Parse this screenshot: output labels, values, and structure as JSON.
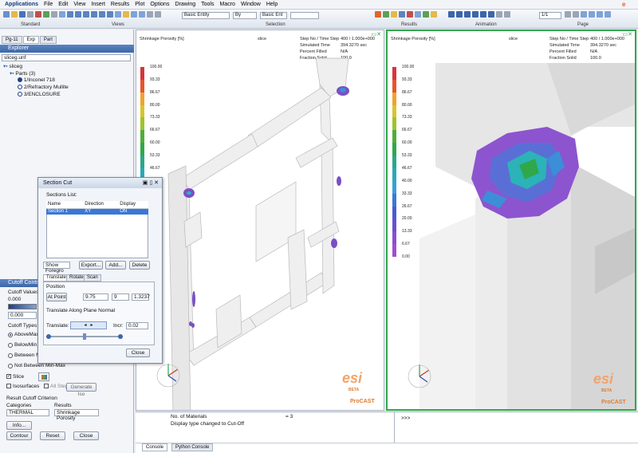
{
  "menubar": {
    "items": [
      "Applications",
      "File",
      "Edit",
      "View",
      "Insert",
      "Results",
      "Plot",
      "Options",
      "Drawing",
      "Tools",
      "Macro",
      "Window",
      "Help"
    ]
  },
  "toolbars": {
    "labels": [
      "Standard",
      "Views",
      "Selection",
      "Results",
      "Animation",
      "Page"
    ],
    "combo_entity": "Basic Entity",
    "combo_by": "By",
    "combo_entity2": "Basic Ent",
    "combo_page": "1/1"
  },
  "sidebar": {
    "tabs": [
      "Pg-11",
      "Exp",
      "Part"
    ],
    "explorer_title": "Explorer",
    "file": "sliceg.unf",
    "tree": [
      "sliceg",
      "Parts (3)",
      "1/Inconel 718",
      "2/Refractory Mullite",
      "3/ENCLOSURE"
    ]
  },
  "cutoff": {
    "title": "Cutoff Control",
    "values_label": "Cutoff Values",
    "value_top": "0.000",
    "value_field": "0.000",
    "types_label": "Cutoff Types",
    "types": [
      "AboveMax",
      "BelowMin",
      "Between Mi",
      "Not Between Min-Max"
    ],
    "slice_label": "Slice",
    "isosurfaces_label": "Isosurfaces",
    "all_steps_label": "All Steps",
    "generate_iso": "Generate Iso",
    "criterion_label": "Result Cutoff Criterion",
    "categories_label": "Categories",
    "results_label": "Results",
    "category_value": "THERMAL",
    "result_value": "Shrinkage Porosity",
    "buttons": [
      "Info...",
      "Contour",
      "Reset",
      "Close"
    ]
  },
  "dialog": {
    "title": "Section Cut",
    "list_label": "Sections List:",
    "columns": [
      "Name",
      "Direction",
      "Display"
    ],
    "rows": [
      [
        "Section 1",
        "XY",
        "ON"
      ]
    ],
    "show_combo": "Show Foregro",
    "export": "Export...",
    "add": "Add...",
    "delete": "Delete",
    "tabs": [
      "Translate",
      "Rotate",
      "Scan"
    ],
    "position_label": "Position",
    "at_point": "At Point",
    "pos_x": "9.75",
    "pos_y": "9",
    "pos_z": "1.3237",
    "along_label": "Translate Along Plane Normal",
    "translate_label": "Translate:",
    "incr_label": "Incr:",
    "incr_value": "0.02",
    "close": "Close"
  },
  "viewport_left": {
    "title": "Shrinkage Porosity [%]",
    "slice": "slice",
    "info_labels": [
      "Step No / Time Step",
      "Simulated Time",
      "Percent Filled",
      "Fraction Solid"
    ],
    "info_values": [
      "400 / 1.000e+000",
      "394.3270 sec",
      "N/A",
      "100.0"
    ],
    "legend": [
      "100.00",
      "93.33",
      "86.67",
      "80.00",
      "73.33",
      "66.67",
      "60.00",
      "53.33",
      "46.67",
      "40.00",
      "33.33",
      "26.67",
      "20.00",
      "13.33",
      "6.67",
      "0.00"
    ]
  },
  "viewport_right": {
    "title": "Shrinkage Porosity [%]",
    "slice": "slice",
    "info_labels": [
      "Step No / Time Step",
      "Simulated Time",
      "Percent Filled",
      "Fraction Solid"
    ],
    "info_values": [
      "400 / 1.000e+000",
      "394.3270 sec",
      "N/A",
      "100.0"
    ],
    "legend": [
      "100.00",
      "93.33",
      "86.67",
      "80.00",
      "73.33",
      "66.67",
      "60.00",
      "53.33",
      "46.67",
      "40.00",
      "33.33",
      "26.67",
      "20.00",
      "13.33",
      "6.67",
      "0.00"
    ]
  },
  "watermark": {
    "esi": "esi",
    "beta": "BETA",
    "product": "ProCAST"
  },
  "console": {
    "line1_label": "No. of Materials",
    "line1_value": "= 3",
    "line2": "Display type changed to Cut-Off",
    "prompt": ">>>",
    "tabs": [
      "Console",
      "Python Console"
    ]
  },
  "colors": {
    "accent": "#3d66a8",
    "selection": "#3a78d6",
    "active_border": "#2fa84a"
  }
}
